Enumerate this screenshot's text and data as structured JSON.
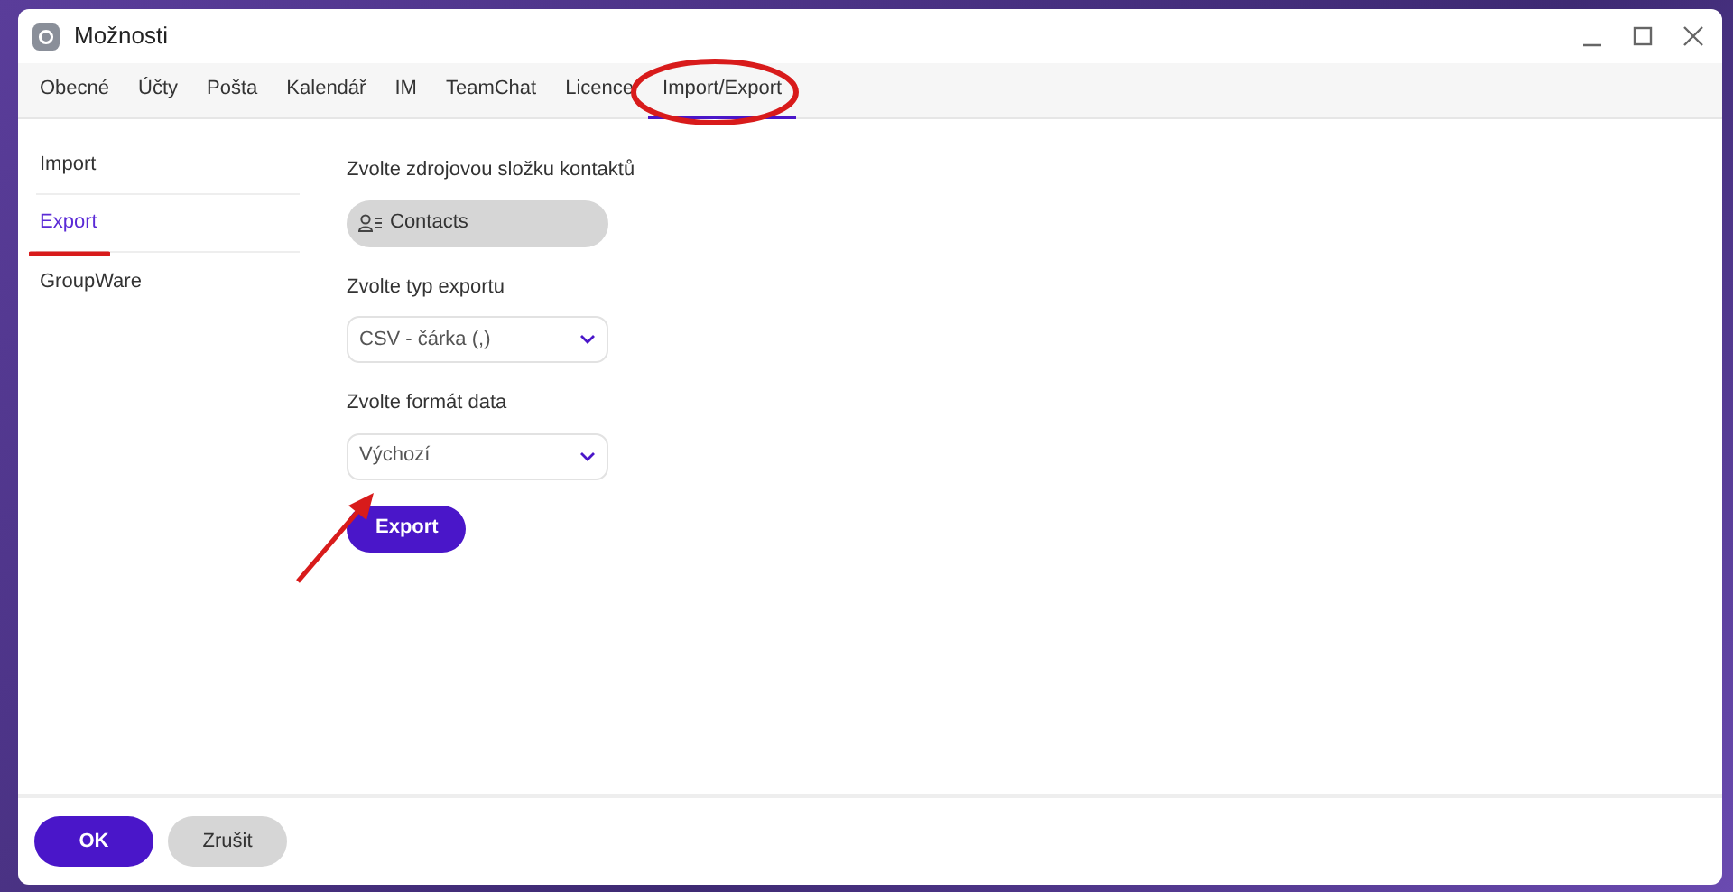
{
  "window": {
    "title": "Možnosti"
  },
  "tabs": [
    {
      "label": "Obecné",
      "selected": false
    },
    {
      "label": "Účty",
      "selected": false
    },
    {
      "label": "Pošta",
      "selected": false
    },
    {
      "label": "Kalendář",
      "selected": false
    },
    {
      "label": "IM",
      "selected": false
    },
    {
      "label": "TeamChat",
      "selected": false
    },
    {
      "label": "Licence",
      "selected": false
    },
    {
      "label": "Import/Export",
      "selected": true
    }
  ],
  "sidebar": {
    "items": [
      {
        "label": "Import",
        "selected": false
      },
      {
        "label": "Export",
        "selected": true
      },
      {
        "label": "GroupWare",
        "selected": false
      }
    ]
  },
  "form": {
    "source_label": "Zvolte zdrojovou složku kontaktů",
    "source_value": "Contacts",
    "type_label": "Zvolte typ exportu",
    "type_value": "CSV - čárka (,)",
    "date_label": "Zvolte formát data",
    "date_value": "Výchozí",
    "submit": "Export"
  },
  "footer": {
    "ok": "OK",
    "cancel": "Zrušit"
  }
}
